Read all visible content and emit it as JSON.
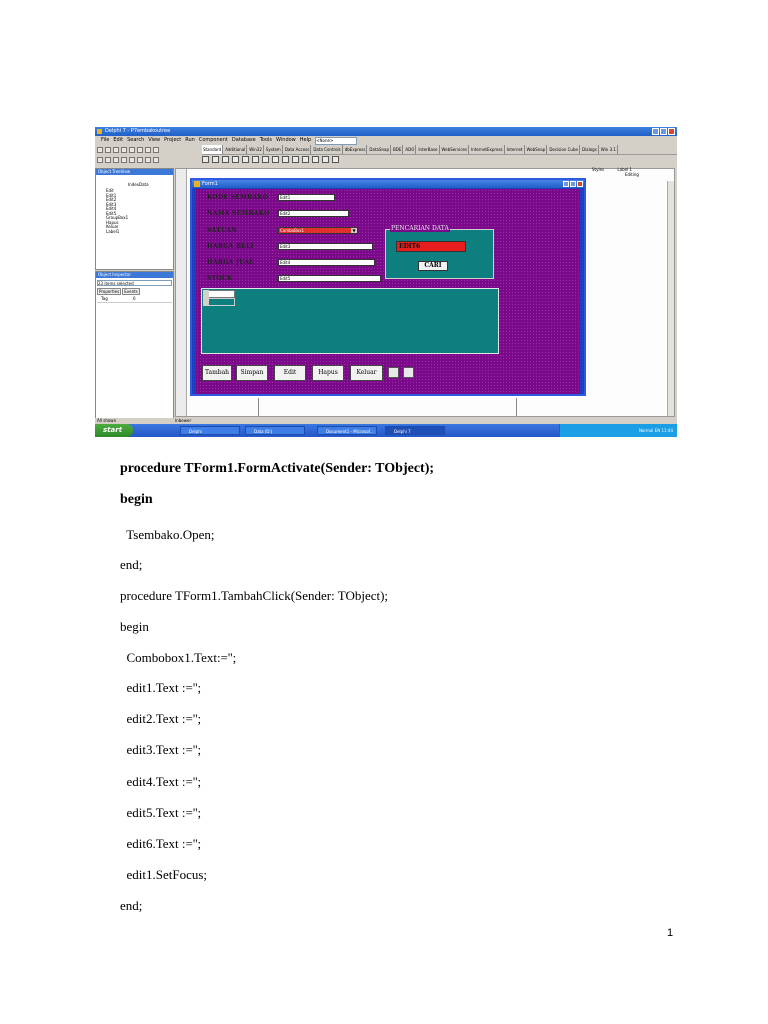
{
  "ide": {
    "window_title": "Delphi 7 - P7embakoutree",
    "menu": [
      "File",
      "Edit",
      "Search",
      "View",
      "Project",
      "Run",
      "Component",
      "Database",
      "Tools",
      "Window",
      "Help"
    ],
    "desktop_combo": "<None>",
    "palette_tabs": [
      "Standard",
      "Additional",
      "Win32",
      "System",
      "Data Access",
      "Data Controls",
      "dbExpress",
      "DataSnap",
      "BDE",
      "ADO",
      "InterBase",
      "WebServices",
      "InternetExpress",
      "Internet",
      "WebSnap",
      "Decision Cube",
      "Dialogs",
      "Win 3.1"
    ],
    "active_palette_tab": "Standard",
    "tree_title": "Object TreeView",
    "tree_root": "IndexData",
    "tree_items": [
      "Edit",
      "Edit1",
      "Edit2",
      "Edit3",
      "Edit4",
      "Edit5",
      "GroupBox1",
      "Hapus",
      "Keluar",
      "Label1"
    ],
    "inspector_title": "Object Inspector",
    "inspector_selection": "23 items selected",
    "inspector_tabs": [
      "Properties",
      "Events"
    ],
    "inspector_prop_key": "Tag",
    "inspector_prop_val": "0",
    "status_left": "All shown",
    "right_styles": "Styles",
    "right_label": "Label 1",
    "right_editing": "Editing",
    "bottom_tab": "Inbewer"
  },
  "form": {
    "title": "Form1",
    "labels": [
      "KODE SEMBAKO",
      "NAMA SEMBAKO",
      "SATUAN",
      "HARGA BELI",
      "HARGA JUAL",
      "STOCK"
    ],
    "edits": [
      "Edit1",
      "Edit2",
      "ComboBox1",
      "Edit3",
      "Edit4",
      "Edit5"
    ],
    "group_title": "PENCARIAN DATA",
    "group_edit": "EDIT6",
    "group_button": "CARI",
    "buttons": [
      "Tambah",
      "Simpan",
      "Edit",
      "Hapus",
      "Keluar"
    ]
  },
  "taskbar": {
    "start": "start",
    "tasks": [
      "Delphi",
      "Data (D:)",
      "Document1 - Microsof...",
      "Delphi 7"
    ],
    "tray": "Normal  EN  11:44"
  },
  "code": [
    "procedure TForm1.FormActivate(Sender: TObject);",
    "begin",
    "  Tsembako.Open;",
    "end;",
    "procedure TForm1.TambahClick(Sender: TObject);",
    "begin",
    "  Combobox1.Text:='';",
    "  edit1.Text :='';",
    "  edit2.Text :='';",
    "  edit3.Text :='';",
    "  edit4.Text :='';",
    "  edit5.Text :='';",
    "  edit6.Text :='';",
    "  edit1.SetFocus;",
    "end;"
  ],
  "page_number": "1"
}
